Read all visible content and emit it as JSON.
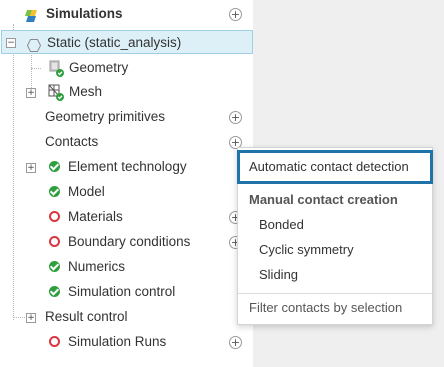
{
  "tree": {
    "root": {
      "label": "Simulations"
    },
    "items": [
      {
        "label": "Static (static_analysis)"
      },
      {
        "label": "Geometry"
      },
      {
        "label": "Mesh"
      },
      {
        "label": "Geometry primitives"
      },
      {
        "label": "Contacts"
      },
      {
        "label": "Element technology",
        "status": "ok"
      },
      {
        "label": "Model",
        "status": "ok"
      },
      {
        "label": "Materials",
        "status": "error"
      },
      {
        "label": "Boundary conditions",
        "status": "error"
      },
      {
        "label": "Numerics",
        "status": "ok"
      },
      {
        "label": "Simulation control",
        "status": "ok"
      },
      {
        "label": "Result control"
      },
      {
        "label": "Simulation Runs",
        "status": "error"
      }
    ],
    "expand_symbol": "+",
    "collapse_symbol": "−",
    "add_symbol": "+"
  },
  "context_menu": {
    "automatic": "Automatic contact detection",
    "manual_header": "Manual contact creation",
    "options": [
      "Bonded",
      "Cyclic symmetry",
      "Sliding"
    ],
    "filter": "Filter contacts by selection"
  },
  "colors": {
    "ok": "#2e9e3e",
    "error": "#d9363e",
    "focus_border": "#1f73a8",
    "selection_bg": "#ddf0f8"
  }
}
